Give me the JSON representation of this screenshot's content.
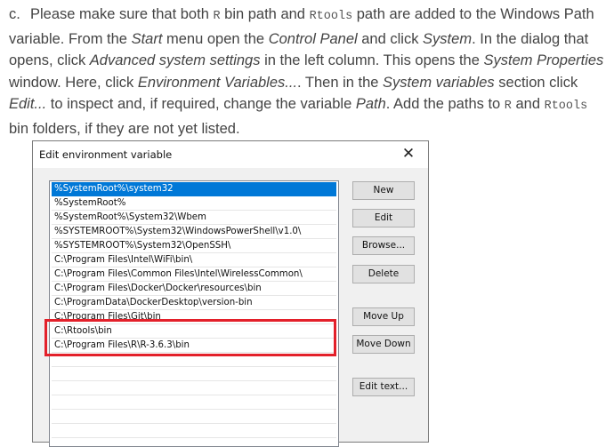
{
  "instructions": {
    "marker": "c.",
    "seg01": "Please make sure that both ",
    "code_r_1": "R",
    "seg02": " bin path and ",
    "code_rtools_1": "Rtools",
    "seg03": " path are added to the Windows Path variable. From the ",
    "em_start": "Start",
    "seg04": " menu open the ",
    "em_control_panel": "Control Panel",
    "seg05": " and click ",
    "em_system": "System",
    "seg06": ". In the dialog that opens, click ",
    "em_advanced": "Advanced system settings",
    "seg07": " in the left column. This opens the ",
    "em_system_properties": "System Properties",
    "seg08": " window. Here, click ",
    "em_env_vars": "Environment Variables...",
    "seg09": ". Then in the ",
    "em_system_vars": "System variables",
    "seg10": " section click ",
    "em_edit": "Edit...",
    "seg11": " to inspect and, if required, change the variable ",
    "em_path": "Path",
    "seg12": ". Add the paths to ",
    "code_r_2": "R",
    "seg13": " and ",
    "code_rtools_2": "Rtools",
    "seg14": " bin folders, if they are not yet listed."
  },
  "dialog": {
    "title": "Edit environment variable",
    "close_glyph": "✕",
    "list_items": [
      "%SystemRoot%\\system32",
      "%SystemRoot%",
      "%SystemRoot%\\System32\\Wbem",
      "%SYSTEMROOT%\\System32\\WindowsPowerShell\\v1.0\\",
      "%SYSTEMROOT%\\System32\\OpenSSH\\",
      "C:\\Program Files\\Intel\\WiFi\\bin\\",
      "C:\\Program Files\\Common Files\\Intel\\WirelessCommon\\",
      "C:\\Program Files\\Docker\\Docker\\resources\\bin",
      "C:\\ProgramData\\DockerDesktop\\version-bin",
      "C:\\Program Files\\Git\\bin",
      "C:\\Rtools\\bin",
      "C:\\Program Files\\R\\R-3.6.3\\bin"
    ],
    "selected_index": 0,
    "highlighted_items": [
      10,
      11
    ],
    "highlight_color": "#e3202a",
    "selection_color": "#0078d7",
    "buttons": {
      "new": "New",
      "edit": "Edit",
      "browse": "Browse...",
      "delete": "Delete",
      "move_up": "Move Up",
      "move_down": "Move Down",
      "edit_text": "Edit text..."
    }
  }
}
